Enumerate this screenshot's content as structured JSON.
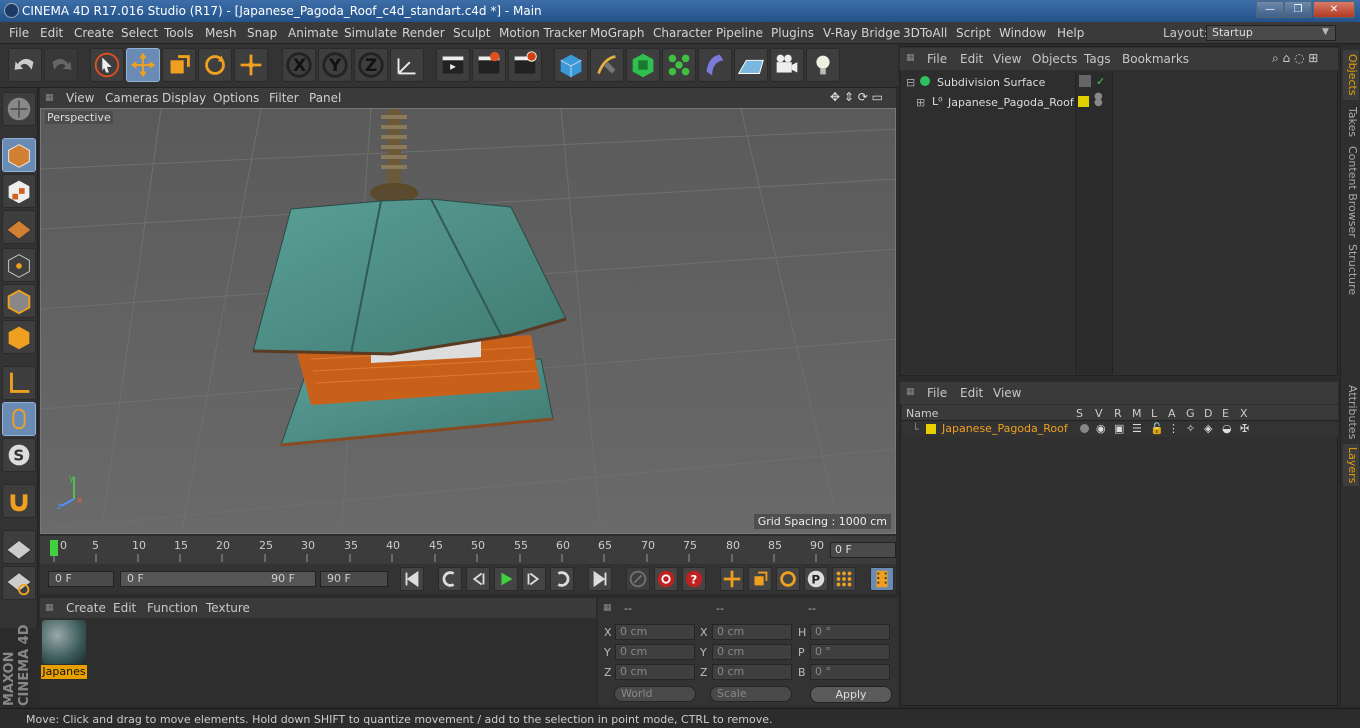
{
  "window": {
    "title": "CINEMA 4D R17.016 Studio (R17) - [Japanese_Pagoda_Roof_c4d_standart.c4d *] - Main",
    "buttons": {
      "minimize": "—",
      "restore": "❐",
      "close": "✕"
    }
  },
  "menu": [
    "File",
    "Edit",
    "Create",
    "Select",
    "Tools",
    "Mesh",
    "Snap",
    "Animate",
    "Simulate",
    "Render",
    "Sculpt",
    "Motion Tracker",
    "MoGraph",
    "Character",
    "Pipeline",
    "Plugins",
    "V-Ray Bridge",
    "3DToAll",
    "Script",
    "Window",
    "Help"
  ],
  "layout": {
    "label": "Layout:",
    "value": "Startup"
  },
  "toolbar": {
    "axis_x": "X",
    "axis_y": "Y",
    "axis_z": "Z"
  },
  "viewport": {
    "menu": [
      "View",
      "Cameras",
      "Display",
      "Options",
      "Filter",
      "Panel"
    ],
    "label": "Perspective",
    "grid_spacing": "Grid Spacing : 1000 cm",
    "colors": {
      "roof": "#4f8f86",
      "wood": "#c8601a",
      "bg": "#5c5c5c"
    }
  },
  "timeline": {
    "ticks": [
      "0",
      "5",
      "10",
      "15",
      "20",
      "25",
      "30",
      "35",
      "40",
      "45",
      "50",
      "55",
      "60",
      "65",
      "70",
      "75",
      "80",
      "85",
      "90"
    ],
    "current_frame": "0 F",
    "start_field": "0 F",
    "range_start": "0 F",
    "range_end": "90 F",
    "end_field": "90 F"
  },
  "material_manager": {
    "menu": [
      "Create",
      "Edit",
      "Function",
      "Texture"
    ],
    "material_name": "Japanes"
  },
  "coordinates": {
    "header": [
      "--",
      "--",
      "--"
    ],
    "rows": [
      {
        "a": "X",
        "av": "0 cm",
        "b": "X",
        "bv": "0 cm",
        "c": "H",
        "cv": "0 °"
      },
      {
        "a": "Y",
        "av": "0 cm",
        "b": "Y",
        "bv": "0 cm",
        "c": "P",
        "cv": "0 °"
      },
      {
        "a": "Z",
        "av": "0 cm",
        "b": "Z",
        "bv": "0 cm",
        "c": "B",
        "cv": "0 °"
      }
    ],
    "world": "World",
    "scale": "Scale",
    "apply": "Apply"
  },
  "object_manager": {
    "menu": [
      "File",
      "Edit",
      "View",
      "Objects",
      "Tags",
      "Bookmarks"
    ],
    "objects": [
      "Subdivision Surface",
      "Japanese_Pagoda_Roof"
    ]
  },
  "layer_manager": {
    "menu": [
      "File",
      "Edit",
      "View"
    ],
    "columns": [
      "Name",
      "S",
      "V",
      "R",
      "M",
      "L",
      "A",
      "G",
      "D",
      "E",
      "X"
    ],
    "layer_name": "Japanese_Pagoda_Roof",
    "layer_color": "#e8d000"
  },
  "side_tabs": [
    "Objects",
    "Takes",
    "Content Browser",
    "Structure",
    "Attributes",
    "Layers"
  ],
  "status": "Move: Click and drag to move elements. Hold down SHIFT to quantize movement / add to the selection in point mode, CTRL to remove.",
  "logo": "MAXON CINEMA 4D"
}
